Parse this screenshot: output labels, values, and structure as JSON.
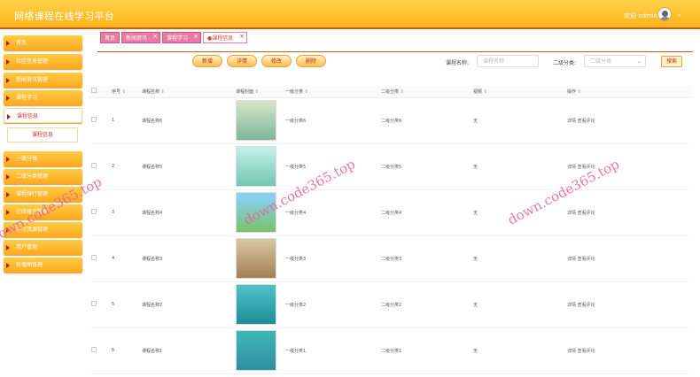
{
  "app": {
    "title": "网络课程在线学习平台",
    "welcome": "欢迎 admin"
  },
  "sidebar": {
    "items": [
      {
        "label": "首页"
      },
      {
        "label": "社区信息管理"
      },
      {
        "label": "新闻资讯管理"
      },
      {
        "label": "课程学习"
      },
      {
        "label": "课程信息"
      },
      {
        "label": "一级分类"
      },
      {
        "label": "二级分类管理"
      },
      {
        "label": "课程排行管理"
      },
      {
        "label": "在线留言管理"
      },
      {
        "label": "学习资源管理"
      },
      {
        "label": "用户管理"
      },
      {
        "label": "轮播图管理"
      }
    ],
    "sub": "课程信息"
  },
  "tabs": [
    {
      "label": "首页"
    },
    {
      "label": "新闻资讯"
    },
    {
      "label": "课程学习"
    },
    {
      "label": "●课程信息"
    }
  ],
  "toolbar": {
    "add": "新增",
    "detail": "详情",
    "edit": "修改",
    "delete": "删除"
  },
  "filters": {
    "name_label": "课程名称:",
    "name_placeholder": "课程名称",
    "cat_label": "二级分类:",
    "cat_value": "二级分类",
    "search": "搜索"
  },
  "table": {
    "headers": [
      "序号",
      "课程名称",
      "课程封面",
      "一级分类",
      "二级分类",
      "视频",
      "操作"
    ],
    "rows": [
      {
        "idx": "1",
        "name": "课程名称6",
        "cat1": "一级分类6",
        "cat2": "二级分类6",
        "video": "无",
        "ops": "详情  查看评论"
      },
      {
        "idx": "2",
        "name": "课程名称5",
        "cat1": "一级分类5",
        "cat2": "二级分类5",
        "video": "无",
        "ops": "详情  查看评论"
      },
      {
        "idx": "3",
        "name": "课程名称4",
        "cat1": "一级分类4",
        "cat2": "二级分类4",
        "video": "无",
        "ops": "详情  查看评论"
      },
      {
        "idx": "4",
        "name": "课程名称3",
        "cat1": "一级分类3",
        "cat2": "二级分类3",
        "video": "无",
        "ops": "详情  查看评论"
      },
      {
        "idx": "5",
        "name": "课程名称2",
        "cat1": "一级分类2",
        "cat2": "二级分类2",
        "video": "无",
        "ops": "详情  查看评论"
      },
      {
        "idx": "6",
        "name": "课程名称1",
        "cat1": "一级分类1",
        "cat2": "二级分类1",
        "video": "无",
        "ops": "详情  查看评论"
      }
    ]
  },
  "watermark": "down.code365.top",
  "colors": {
    "header": "#ffb21a",
    "accent": "#b4151d",
    "tab": "#e97aa8"
  }
}
